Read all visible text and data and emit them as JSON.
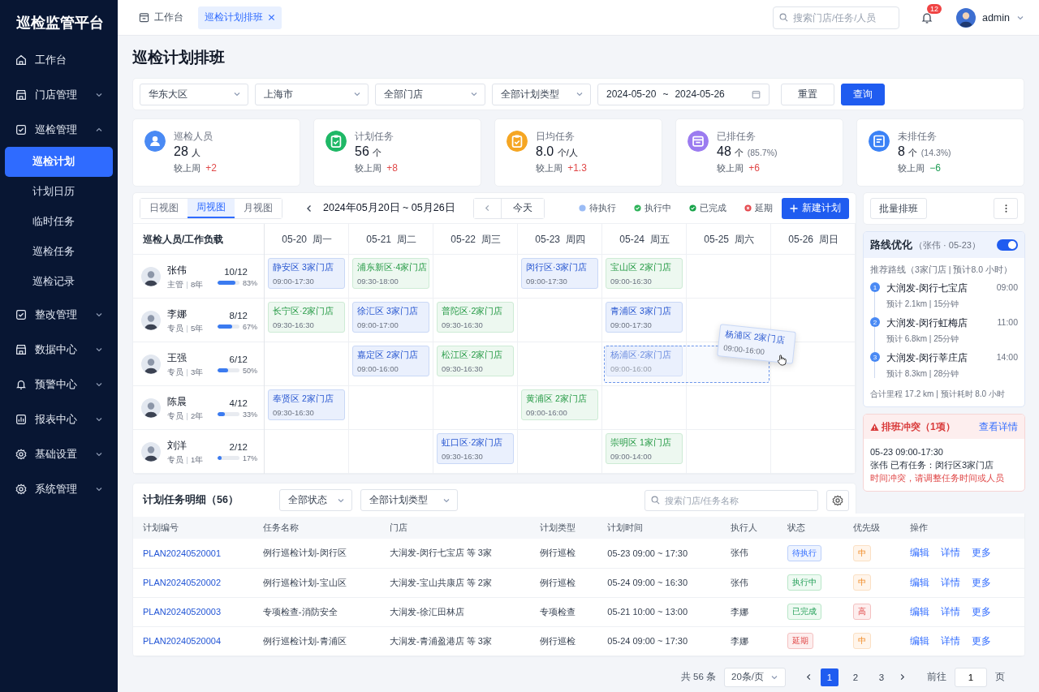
{
  "sidebar": {
    "title": "巡检监管平台",
    "items": [
      {
        "label": "工作台",
        "kind": "link",
        "selected": false
      },
      {
        "label": "门店管理",
        "kind": "group",
        "expanded": false,
        "selected": false
      },
      {
        "label": "巡检管理",
        "kind": "group",
        "expanded": true,
        "selected": false,
        "children": [
          {
            "label": "巡检计划",
            "selected": true
          },
          {
            "label": "计划日历",
            "selected": false
          },
          {
            "label": "临时任务",
            "selected": false
          },
          {
            "label": "巡检任务",
            "selected": false
          },
          {
            "label": "巡检记录",
            "selected": false
          }
        ]
      },
      {
        "label": "整改管理",
        "kind": "group",
        "expanded": false,
        "selected": false
      },
      {
        "label": "数据中心",
        "kind": "group",
        "expanded": false,
        "selected": false
      },
      {
        "label": "预警中心",
        "kind": "group",
        "expanded": false,
        "selected": false
      },
      {
        "label": "报表中心",
        "kind": "group",
        "expanded": false,
        "selected": false
      },
      {
        "label": "基础设置",
        "kind": "group",
        "expanded": false,
        "selected": false
      },
      {
        "label": "系统管理",
        "kind": "group",
        "expanded": false,
        "selected": false
      }
    ]
  },
  "header": {
    "tabs": [
      {
        "label": "工作台",
        "selected": false,
        "kind": "home"
      },
      {
        "label": "巡检计划排班",
        "selected": true,
        "kind": "closable"
      }
    ],
    "search": {
      "placeholder": "搜索门店/任务/人员"
    },
    "notifications": "12",
    "user": "admin"
  },
  "page_title": "巡检计划排班",
  "filters": {
    "selects": [
      "华东大区",
      "上海市",
      "全部门店",
      "全部计划类型"
    ],
    "date_start": "2024-05-20",
    "date_separator": "~",
    "date_end": "2024-05-26",
    "reset_button": "重置",
    "query_button": "查询"
  },
  "stats": [
    {
      "label": "巡检人员",
      "value": "28",
      "unit": "人",
      "compare_label": "较上周",
      "delta": {
        "text": "+2",
        "color": "#e04848"
      },
      "color": "#4a8af4"
    },
    {
      "label": "计划任务",
      "value": "56",
      "unit": "个",
      "compare_label": "较上周",
      "delta": {
        "text": "+8",
        "color": "#e04848"
      },
      "color": "#1fb866"
    },
    {
      "label": "日均任务",
      "value": "8.0",
      "unit": "个/人",
      "compare_label": "较上周",
      "delta": {
        "text": "+1.3",
        "color": "#e04848"
      },
      "color": "#f5a623"
    },
    {
      "label": "已排任务",
      "value": "48",
      "unit": "个",
      "extra": "(85.7%)",
      "compare_label": "较上周",
      "delta": {
        "text": "+6",
        "color": "#e04848"
      },
      "color": "#9b7bf0"
    },
    {
      "label": "未排任务",
      "value": "8",
      "unit": "个",
      "extra": "(14.3%)",
      "compare_label": "较上周",
      "delta": {
        "text": "−6",
        "color": "#1f9d55"
      },
      "color": "#3b82f6"
    }
  ],
  "schedule": {
    "views": [
      {
        "label": "日视图",
        "selected": false
      },
      {
        "label": "周视图",
        "selected": true
      },
      {
        "label": "月视图",
        "selected": false
      }
    ],
    "range": "2024年05月20日 ~ 05月26日",
    "today_button": "今天",
    "legend": [
      {
        "label": "待执行",
        "kind": "pending"
      },
      {
        "label": "执行中",
        "kind": "running"
      },
      {
        "label": "已完成",
        "kind": "done"
      },
      {
        "label": "延期",
        "kind": "delayed"
      }
    ],
    "new_button": "新建计划",
    "person_header": "巡检人员/工作负载",
    "days": [
      {
        "date": "05-20",
        "weekday": "周一"
      },
      {
        "date": "05-21",
        "weekday": "周二"
      },
      {
        "date": "05-22",
        "weekday": "周三"
      },
      {
        "date": "05-23",
        "weekday": "周四"
      },
      {
        "date": "05-24",
        "weekday": "周五"
      },
      {
        "date": "05-25",
        "weekday": "周六"
      },
      {
        "date": "05-26",
        "weekday": "周日"
      }
    ],
    "people": [
      {
        "name": "张伟",
        "role": "主管",
        "tenure": "8年",
        "load": "10/12",
        "level": 0.83,
        "percent": "83%",
        "cells": [
          {
            "title": "静安区  3家门店",
            "time": "09:00-17:30",
            "kind": "pending",
            "dragging": false
          },
          {
            "title": "浦东新区·4家门店",
            "time": "09:30-18:00",
            "kind": "running",
            "dragging": false
          },
          null,
          {
            "title": "闵行区·3家门店",
            "time": "09:00-17:30",
            "kind": "pending",
            "dragging": false
          },
          {
            "title": "宝山区  2家门店",
            "time": "09:00-16:30",
            "kind": "running",
            "dragging": false
          },
          null,
          null
        ]
      },
      {
        "name": "李娜",
        "role": "专员",
        "tenure": "5年",
        "load": "8/12",
        "level": 0.67,
        "percent": "67%",
        "cells": [
          {
            "title": "长宁区·2家门店",
            "time": "09:30-16:30",
            "kind": "running",
            "dragging": false
          },
          {
            "title": "徐汇区  3家门店",
            "time": "09:00-17:00",
            "kind": "pending",
            "dragging": false
          },
          {
            "title": "普陀区·2家门店",
            "time": "09:30-16:30",
            "kind": "running",
            "dragging": false
          },
          null,
          {
            "title": "青浦区  3家门店",
            "time": "09:00-17:30",
            "kind": "pending",
            "dragging": false
          },
          null,
          null
        ]
      },
      {
        "name": "王强",
        "role": "专员",
        "tenure": "3年",
        "load": "6/12",
        "level": 0.5,
        "percent": "50%",
        "cells": [
          null,
          {
            "title": "嘉定区  2家门店",
            "time": "09:00-16:00",
            "kind": "pending",
            "dragging": false
          },
          {
            "title": "松江区·2家门店",
            "time": "09:30-16:30",
            "kind": "running",
            "dragging": false
          },
          null,
          {
            "title": "杨浦区·2家门店",
            "time": "09:00-16:00",
            "kind": "pending",
            "dragging": true,
            "ghost": {
              "title": "杨浦区  2家门店",
              "time": "09:00-16:00"
            }
          },
          null,
          null
        ]
      },
      {
        "name": "陈晨",
        "role": "专员",
        "tenure": "2年",
        "load": "4/12",
        "level": 0.33,
        "percent": "33%",
        "cells": [
          {
            "title": "奉贤区  2家门店",
            "time": "09:30-16:30",
            "kind": "pending",
            "dragging": false
          },
          null,
          null,
          {
            "title": "黄浦区  2家门店",
            "time": "09:00-16:00",
            "kind": "running",
            "dragging": false
          },
          null,
          null,
          null
        ]
      },
      {
        "name": "刘洋",
        "role": "专员",
        "tenure": "1年",
        "load": "2/12",
        "level": 0.17,
        "percent": "17%",
        "cells": [
          null,
          null,
          {
            "title": "虹口区·2家门店",
            "time": "09:30-16:30",
            "kind": "pending",
            "dragging": false
          },
          null,
          {
            "title": "崇明区  1家门店",
            "time": "09:00-14:00",
            "kind": "running",
            "dragging": false
          },
          null,
          null
        ]
      }
    ]
  },
  "side": {
    "batch_button": "批量排班",
    "route": {
      "title": "路线优化",
      "subtitle": "（张伟 · 05-23）",
      "on": true,
      "summary": "推荐路线（3家门店 | 预计8.0 小时）",
      "stops": [
        {
          "index": "1",
          "name": "大润发-闵行七宝店",
          "time": "09:00",
          "detail": "预计  2.1km  |  15分钟"
        },
        {
          "index": "2",
          "name": "大润发-闵行虹梅店",
          "time": "11:00",
          "detail": "预计  6.8km  |  25分钟"
        },
        {
          "index": "3",
          "name": "大润发-闵行莘庄店",
          "time": "14:00",
          "detail": "预计  8.3km  |  28分钟"
        }
      ],
      "total": "合计里程  17.2 km  |  预计耗时  8.0 小时"
    },
    "conflict": {
      "title": "排班冲突（1项）",
      "link": "查看详情",
      "time": "05-23 09:00-17:30",
      "detail": "张伟  已有任务：闵行区3家门店",
      "warning": "时间冲突，请调整任务时间或人员"
    }
  },
  "table": {
    "title": "计划任务明细（56）",
    "status_filter": "全部状态",
    "type_filter": "全部计划类型",
    "search": {
      "placeholder": "搜索门店/任务名称"
    },
    "columns": [
      "计划编号",
      "任务名称",
      "门店",
      "计划类型",
      "计划时间",
      "执行人",
      "状态",
      "优先级",
      "操作"
    ],
    "rows": [
      {
        "id": "PLAN20240520001",
        "name": "例行巡检计划-闵行区",
        "store": "大润发-闵行七宝店 等 3家",
        "type": "例行巡检",
        "time": "05-23  09:00 ~ 17:30",
        "assignee": "张伟",
        "status": {
          "label": "待执行",
          "kind": "pending"
        },
        "priority": {
          "label": "中",
          "kind": "medium"
        },
        "actions": [
          "编辑",
          "详情",
          "更多"
        ]
      },
      {
        "id": "PLAN20240520002",
        "name": "例行巡检计划-宝山区",
        "store": "大润发-宝山共康店 等 2家",
        "type": "例行巡检",
        "time": "05-24  09:00 ~ 16:30",
        "assignee": "张伟",
        "status": {
          "label": "执行中",
          "kind": "running"
        },
        "priority": {
          "label": "中",
          "kind": "medium"
        },
        "actions": [
          "编辑",
          "详情",
          "更多"
        ]
      },
      {
        "id": "PLAN20240520003",
        "name": "专项检查-消防安全",
        "store": "大润发-徐汇田林店",
        "type": "专项检查",
        "time": "05-21  10:00 ~ 13:00",
        "assignee": "李娜",
        "status": {
          "label": "已完成",
          "kind": "done"
        },
        "priority": {
          "label": "高",
          "kind": "high"
        },
        "actions": [
          "编辑",
          "详情",
          "更多"
        ]
      },
      {
        "id": "PLAN20240520004",
        "name": "例行巡检计划-青浦区",
        "store": "大润发-青浦盈港店 等 3家",
        "type": "例行巡检",
        "time": "05-24  09:00 ~ 17:30",
        "assignee": "李娜",
        "status": {
          "label": "延期",
          "kind": "delayed"
        },
        "priority": {
          "label": "中",
          "kind": "medium"
        },
        "actions": [
          "编辑",
          "详情",
          "更多"
        ]
      }
    ]
  },
  "pagination": {
    "total": "共 56 条",
    "page_size": "20条/页",
    "pages": [
      {
        "label": "1",
        "selected": true
      },
      {
        "label": "2",
        "selected": false
      },
      {
        "label": "3",
        "selected": false
      }
    ],
    "goto_label": "前往",
    "goto_value": "1",
    "page_suffix": "页"
  }
}
